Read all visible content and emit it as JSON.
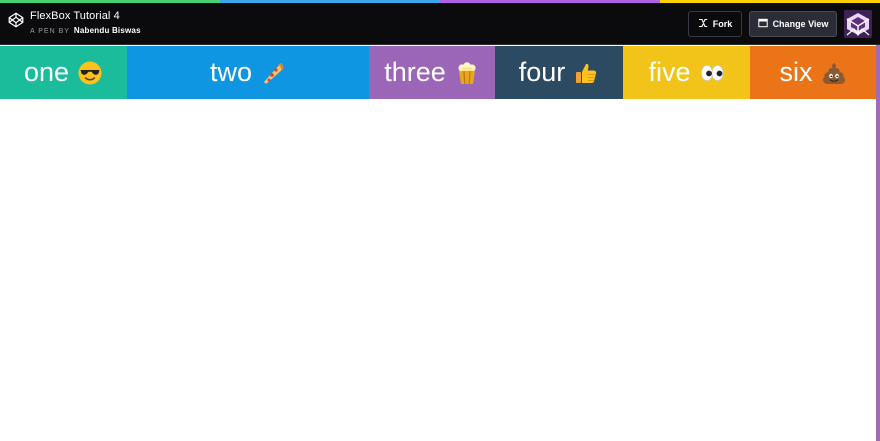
{
  "header": {
    "title": "FlexBox Tutorial 4",
    "by_prefix": "A PEN BY",
    "author": "Nabendu Biswas",
    "fork_label": "Fork",
    "change_view_label": "Change View"
  },
  "colors": {
    "header_bg": "#0b0b0d",
    "accent_edge": "#a06ab4"
  },
  "boxes": [
    {
      "label": "one",
      "emoji": "sunglasses-face-icon",
      "color": "#1abc9c"
    },
    {
      "label": "two",
      "emoji": "pizza-icon",
      "color": "#0f96e2"
    },
    {
      "label": "three",
      "emoji": "popcorn-icon",
      "color": "#9b66b8"
    },
    {
      "label": "four",
      "emoji": "thumbs-up-icon",
      "color": "#2c4b62"
    },
    {
      "label": "five",
      "emoji": "eyes-icon",
      "color": "#f2c41a"
    },
    {
      "label": "six",
      "emoji": "poop-icon",
      "color": "#ea7417"
    }
  ]
}
